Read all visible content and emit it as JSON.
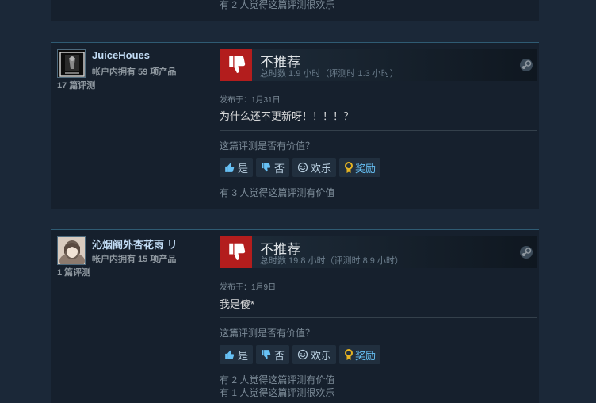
{
  "top_card": {
    "helpful_text": "有 2 人觉得这篇评测很欢乐"
  },
  "reviews": [
    {
      "author": {
        "name": "JuiceHoues",
        "owned": "帐户内拥有 59 项产品",
        "reviews": "17 篇评测"
      },
      "verdict": "不推荐",
      "hours": "总时数 1.9 小时（评测时 1.3 小时）",
      "posted": "发布于：1月31日",
      "content": "为什么还不更新呀！！！！？",
      "question": "这篇评测是否有价值？",
      "buttons": {
        "yes": "是",
        "no": "否",
        "funny": "欢乐",
        "award": "奖励"
      },
      "helpful": [
        "有 3 人觉得这篇评测有价值"
      ]
    },
    {
      "author": {
        "name": "沁烟阁外杏花雨 リ",
        "owned": "帐户内拥有 15 项产品",
        "reviews": "1 篇评测"
      },
      "verdict": "不推荐",
      "hours": "总时数 19.8 小时（评测时 8.9 小时）",
      "posted": "发布于：1月9日",
      "content": "我是傻*",
      "question": "这篇评测是否有价值？",
      "buttons": {
        "yes": "是",
        "no": "否",
        "funny": "欢乐",
        "award": "奖励"
      },
      "helpful": [
        "有 2 人觉得这篇评测有价值",
        "有 1 人觉得这篇评测很欢乐"
      ]
    }
  ],
  "colors": {
    "background": "#1b2838",
    "card": "#16202d",
    "thumb_down": "#b31d1d",
    "link": "#67c1f5"
  },
  "icons": {
    "verdict": "thumbs-down-icon",
    "platform": "steam-icon",
    "yes": "thumbs-up-icon",
    "no": "thumbs-down-icon",
    "funny": "smiley-icon",
    "award": "award-icon"
  }
}
